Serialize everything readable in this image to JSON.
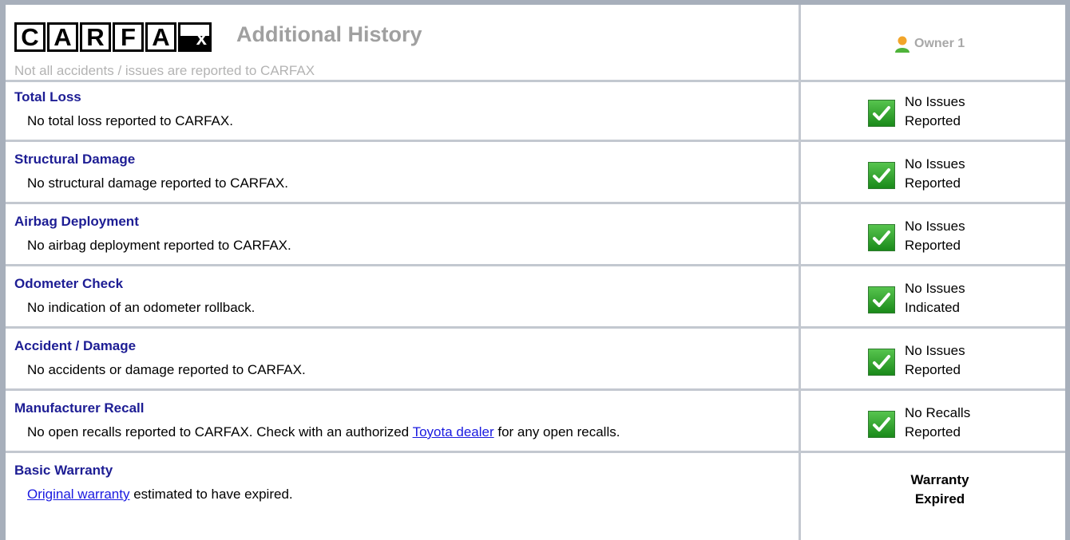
{
  "header": {
    "logo_letters": [
      "C",
      "A",
      "R",
      "F",
      "A",
      "x"
    ],
    "title": "Additional History",
    "subtitle": "Not all accidents / issues are reported to CARFAX",
    "owner_label": "Owner 1",
    "owner_icon": "person-icon"
  },
  "rows": [
    {
      "title": "Total Loss",
      "desc": "No total loss reported to CARFAX.",
      "status_line1": "No Issues",
      "status_line2": "Reported"
    },
    {
      "title": "Structural Damage",
      "desc": "No structural damage reported to CARFAX.",
      "status_line1": "No Issues",
      "status_line2": "Reported"
    },
    {
      "title": "Airbag Deployment",
      "desc": "No airbag deployment reported to CARFAX.",
      "status_line1": "No Issues",
      "status_line2": "Reported"
    },
    {
      "title": "Odometer Check",
      "desc": "No indication of an odometer rollback.",
      "status_line1": "No Issues",
      "status_line2": "Indicated"
    },
    {
      "title": "Accident / Damage",
      "desc": "No accidents or damage reported to CARFAX.",
      "status_line1": "No Issues",
      "status_line2": "Reported"
    },
    {
      "title": "Manufacturer Recall",
      "desc_pre": "No open recalls reported to CARFAX. Check with an authorized ",
      "desc_link": "Toyota dealer",
      "desc_post": " for any open recalls.",
      "status_line1": "No Recalls",
      "status_line2": "Reported"
    },
    {
      "title": "Basic Warranty",
      "desc_link": "Original warranty",
      "desc_post": " estimated to have expired.",
      "status_line1": "Warranty",
      "status_line2": "Expired"
    }
  ],
  "colors": {
    "title": "#1d1d94",
    "link": "#1a1ae0",
    "check_green": "#2ea32a",
    "border": "#a7afbb"
  }
}
